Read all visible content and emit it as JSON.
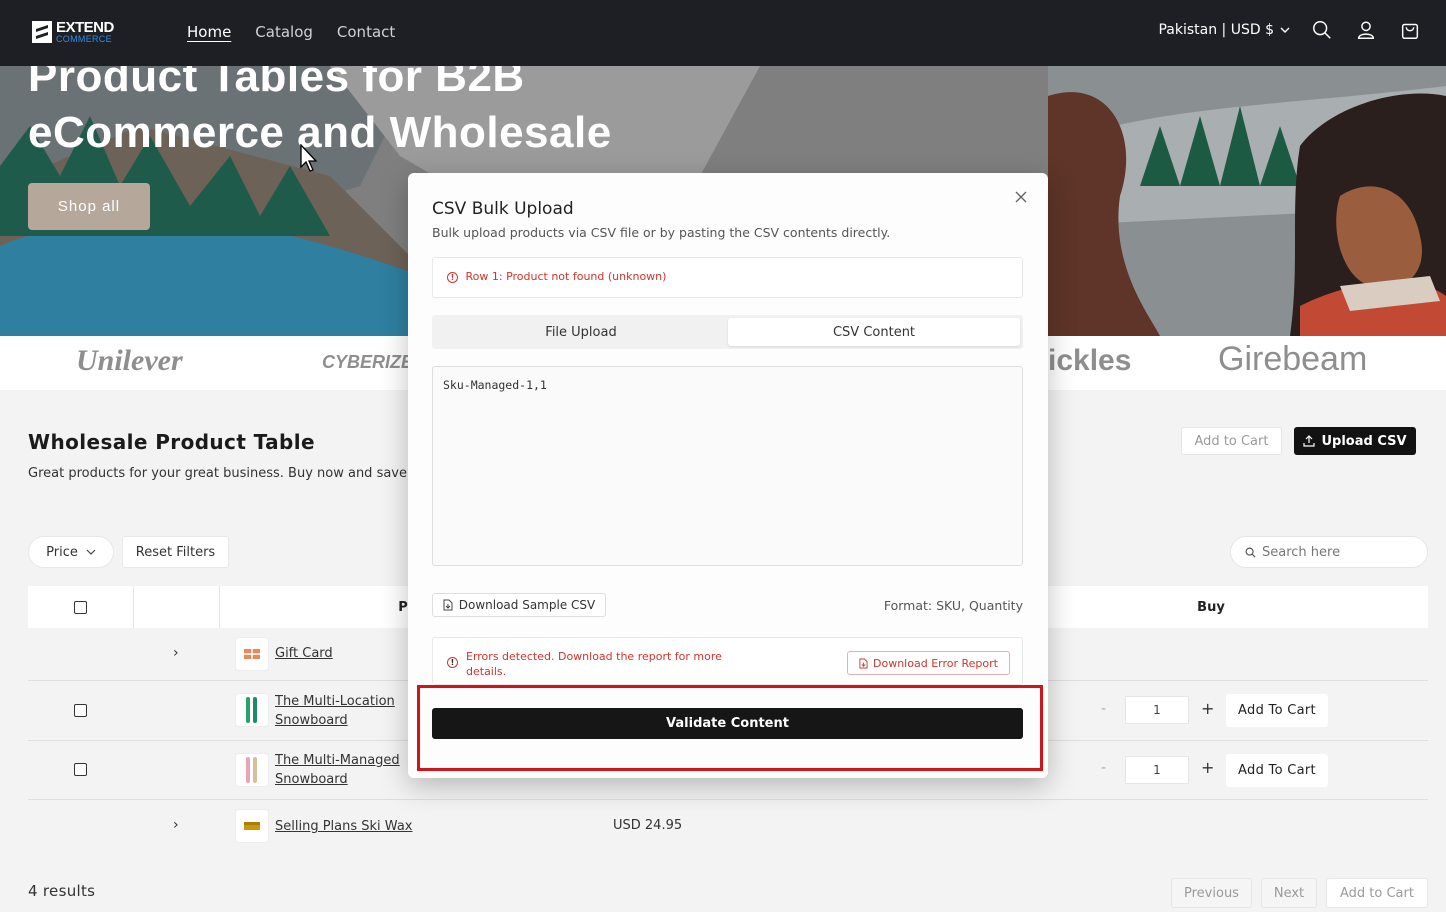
{
  "header": {
    "logo_top": "EXTEND",
    "logo_bottom": "COMMERCE",
    "nav": [
      "Home",
      "Catalog",
      "Contact"
    ],
    "locale": "Pakistan | USD $"
  },
  "hero": {
    "title_line1": "Product Tables for B2B",
    "title_line2": "eCommerce and Wholesale",
    "cta": "Shop all"
  },
  "brands": [
    "Unilever",
    "CYBERIZE",
    "ickles",
    "Girebeam"
  ],
  "section": {
    "title": "Wholesale Product Table",
    "description": "Great products for your great business. Buy now and save up",
    "add_to_cart": "Add to Cart",
    "upload_csv": "Upload CSV",
    "filter_price": "Price",
    "reset_filters": "Reset Filters",
    "search_placeholder": "Search here"
  },
  "table": {
    "headers": [
      "",
      "",
      "Produ",
      "Buy"
    ],
    "rows": [
      {
        "name": "Gift Card",
        "price": "",
        "qty": "",
        "buy": ""
      },
      {
        "name_line1": "The Multi-Location",
        "name_line2": "Snowboard",
        "qty": "1",
        "buy": "Add To Cart"
      },
      {
        "name_line1": "The Multi-Managed",
        "name_line2": "Snowboard",
        "qty": "1",
        "buy": "Add To Cart"
      },
      {
        "name": "Selling Plans Ski Wax",
        "price": "USD 24.95"
      }
    ],
    "qty_minus": "-",
    "qty_plus": "+"
  },
  "footer": {
    "results": "4 results",
    "previous": "Previous",
    "next": "Next",
    "add_to_cart": "Add to Cart"
  },
  "modal": {
    "title": "CSV Bulk Upload",
    "subtitle": "Bulk upload products via CSV file or by pasting the CSV contents directly.",
    "alert": "Row 1: Product not found (unknown)",
    "tabs": [
      "File Upload",
      "CSV Content"
    ],
    "active_tab": "CSV Content",
    "csv_content": "Sku-Managed-1,1",
    "download_sample": "Download Sample CSV",
    "format": "Format: SKU, Quantity",
    "error_text": "Errors detected. Download the report for more details.",
    "download_error": "Download Error Report",
    "validate": "Validate Content",
    "close": "×"
  },
  "colors": {
    "header_bg": "#1d1f24",
    "error": "#d0342c",
    "highlight": "#d0141a",
    "primary_button": "#161616"
  }
}
